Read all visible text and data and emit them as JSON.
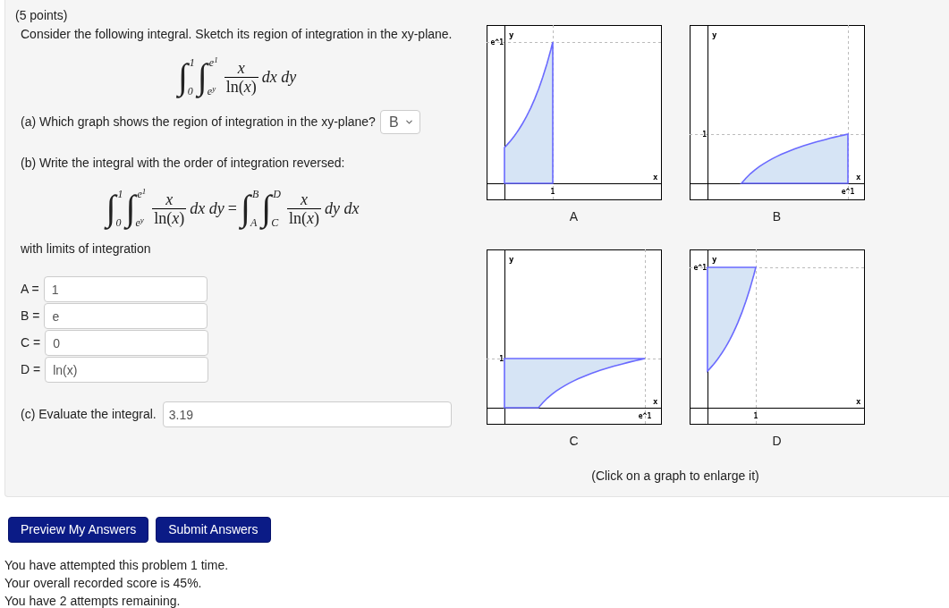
{
  "points": "(5 points)",
  "prompt": "Consider the following integral. Sketch its region of integration in the xy-plane.",
  "integral": {
    "integrals": [
      {
        "sign": "∫",
        "lower": "0",
        "upper": "1"
      },
      {
        "sign": "∫",
        "lower": "e$^{y}$",
        "upper": "e$^{1}$"
      }
    ],
    "numerator": "x",
    "denominator": "ln(*x*)",
    "differentials": "dx dy"
  },
  "part_a": {
    "question": "(a) Which graph shows the region of integration in the xy-plane?",
    "select": {
      "value": "B"
    }
  },
  "part_b": {
    "question": "(b) Write the integral with the order of integration reversed:",
    "equation": {
      "left": {
        "integrals": [
          {
            "sign": "∫",
            "lower": "0",
            "upper": "1"
          },
          {
            "sign": "∫",
            "lower": "e$^{y}$",
            "upper": "e$^{1}$"
          }
        ],
        "numerator": "x",
        "denominator": "ln(*x*)",
        "differentials": "dx dy"
      },
      "equals": "=",
      "right": {
        "integrals": [
          {
            "sign": "∫",
            "lower": "A",
            "upper": "B"
          },
          {
            "sign": "∫",
            "lower": "C",
            "upper": "D"
          }
        ],
        "numerator": "x",
        "denominator": "ln(*x*)",
        "differentials": "dy dx"
      }
    },
    "limits_label": "with limits of integration",
    "fields": [
      {
        "label": "A =",
        "value": "1"
      },
      {
        "label": "B =",
        "value": "e"
      },
      {
        "label": "C =",
        "value": "0"
      },
      {
        "label": "D =",
        "value": "ln(x)"
      }
    ]
  },
  "part_c": {
    "question": "(c) Evaluate the integral.",
    "value": "3.19"
  },
  "graphs": [
    {
      "kind": "under-exp",
      "caption": "A",
      "x_axis": "x",
      "y_axis": "y",
      "x_tick": "1",
      "y_tick": "e^1"
    },
    {
      "kind": "under-log",
      "caption": "B",
      "x_axis": "x",
      "y_axis": "y",
      "x_tick": "e^1",
      "y_tick": "1"
    },
    {
      "kind": "over-log",
      "caption": "C",
      "x_axis": "x",
      "y_axis": "y",
      "x_tick": "e^1",
      "y_tick": "1"
    },
    {
      "kind": "over-exp",
      "caption": "D",
      "x_axis": "x",
      "y_axis": "y",
      "x_tick": "1",
      "y_tick": "e^1"
    }
  ],
  "graphs_note": "(Click on a graph to enlarge it)",
  "buttons": [
    "Preview My Answers",
    "Submit Answers"
  ],
  "messages": [
    "You have attempted this problem 1 time.",
    "Your overall recorded score is 45%.",
    "You have 2 attempts remaining."
  ]
}
